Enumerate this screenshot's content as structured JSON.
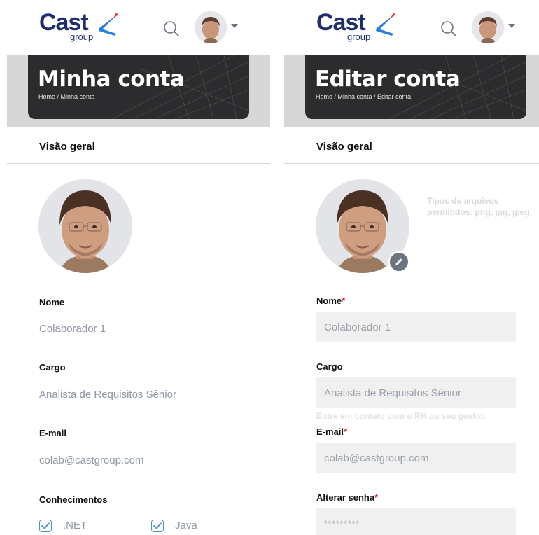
{
  "brand": {
    "logo_text": "Cast",
    "logo_sub": "group"
  },
  "header": {
    "search_icon": "search-icon",
    "avatar_icon": "user-avatar",
    "menu_icon": "chevron-down-icon"
  },
  "left": {
    "banner": {
      "title": "Minha conta",
      "breadcrumb": "Home / Minha conta"
    },
    "section_title": "Visão geral",
    "fields": {
      "nome": {
        "label": "Nome",
        "value": "Colaborador 1"
      },
      "cargo": {
        "label": "Cargo",
        "value": "Analista de Requisitos Sênior"
      },
      "email": {
        "label": "E-mail",
        "value": "colab@castgroup.com"
      }
    },
    "conhecimentos": {
      "label": "Conhecimentos",
      "items": [
        {
          "label": ".NET",
          "checked": true
        },
        {
          "label": "Java",
          "checked": true
        }
      ]
    }
  },
  "right": {
    "banner": {
      "title": "Editar conta",
      "breadcrumb": "Home / Minha conta / Editar conta"
    },
    "section_title": "Visão geral",
    "file_hint": "Tipos de arquivos permitidos: png, jpg, jpeg.",
    "fields": {
      "nome": {
        "label": "Nome",
        "value": "Colaborador 1"
      },
      "cargo": {
        "label": "Cargo",
        "value": "Analista de Requisitos Sênior",
        "help": "Entre em contato com o RH ou seu gestor."
      },
      "email": {
        "label": "E-mail",
        "value": "colab@castgroup.com"
      },
      "senha": {
        "label": "Alterar senha",
        "value": "*********"
      }
    },
    "required_mark": "*"
  },
  "colors": {
    "brand_navy": "#1e2e6e",
    "brand_blue": "#2a7de1",
    "required": "#d9232e",
    "checkbox": "#4d8ec9"
  }
}
